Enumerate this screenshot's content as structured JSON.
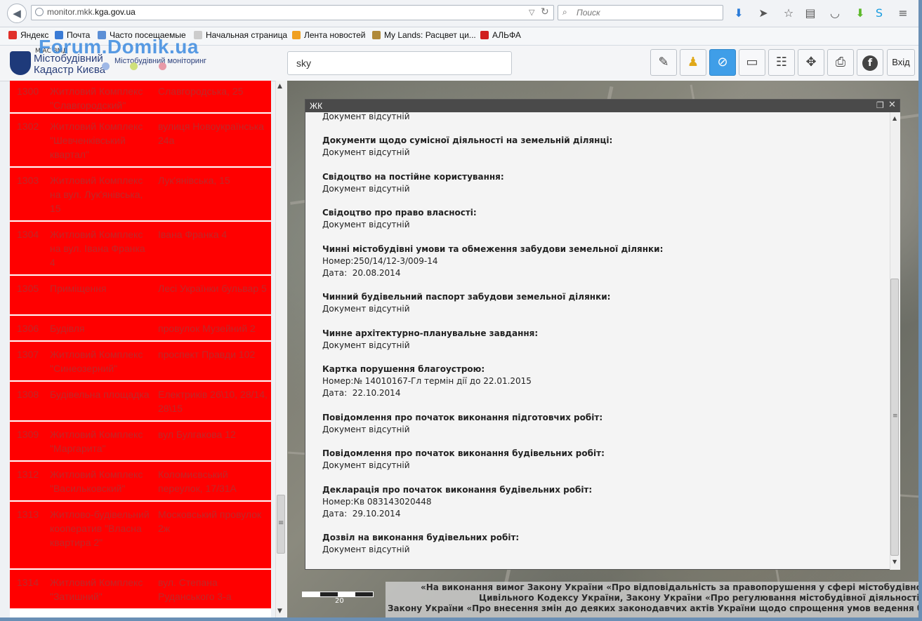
{
  "browser": {
    "url_prefix": "monitor.mkk.",
    "url_domain": "kga.gov.ua",
    "search_placeholder": "Поиск"
  },
  "bookmarks": [
    {
      "label": "Яндекс",
      "color": "#e0302a"
    },
    {
      "label": "Почта",
      "color": "#3a7bd5"
    },
    {
      "label": "Часто посещаемые",
      "color": "#5b8fd6"
    },
    {
      "label": "Начальная страница",
      "color": "#cccccc"
    },
    {
      "label": "Лента новостей",
      "color": "#f0a020"
    },
    {
      "label": "My Lands: Расцвет ци...",
      "color": "#b08a3a"
    },
    {
      "label": "АЛЬФА",
      "color": "#d02020"
    }
  ],
  "app": {
    "logo_top": "МІАС ЗМД",
    "logo_line1": "Містобудівний",
    "logo_line2": "Кадастр Києва",
    "logo_sub": "Містобудівний моніторинг",
    "watermark": "Forum.Domik.ua",
    "search_value": "sky",
    "exit_label": "Вхід"
  },
  "list": [
    {
      "id": "1300",
      "name": "Житловий Комплекс \"Славгородский\"",
      "address": "Славгородська, 25"
    },
    {
      "id": "1302",
      "name": "Житловий Комплекс \"Шевченківський квартал\"",
      "address": "вулиця Новоукраїнська 24а"
    },
    {
      "id": "1303",
      "name": "Житловий Комплекс на вул. Лук'янівська, 15",
      "address": "Лук'янівська, 15"
    },
    {
      "id": "1304",
      "name": "Житловий Комплекс на вул. Івана Франка 4",
      "address": "Івана Франка 4"
    },
    {
      "id": "1305",
      "name": "Приміщення",
      "address": "Лесі Українки бульвар 5"
    },
    {
      "id": "1306",
      "name": "Будівля",
      "address": "провулок Музейний 2"
    },
    {
      "id": "1307",
      "name": "Житловий Комплекс \"Синеозерний\"",
      "address": "проспект Правди 102"
    },
    {
      "id": "1308",
      "name": "Будівельна площадка",
      "address": "Електриків 26\\10, 28/14, 28\\15"
    },
    {
      "id": "1309",
      "name": "Житловий Комплекс \"Маргарита\"",
      "address": "вул Булгакова 12"
    },
    {
      "id": "1312",
      "name": "Житловий Комплекс \"Васильковский\"",
      "address": "Коломиєвський переулок, 17/31А"
    },
    {
      "id": "1313",
      "name": "Житлово-будівельний кооператив \"Власна квартира 2\"",
      "address": "Московський провулок 2ж"
    },
    {
      "id": "1314",
      "name": "Житловий Комплекс \"Затишний\"",
      "address": "вул. Степана Руданського 3-а"
    }
  ],
  "popup": {
    "title": "ЖК",
    "sections": [
      {
        "heading": "",
        "lines": [
          "Документ відсутній"
        ]
      },
      {
        "heading": "Документи щодо сумісної діяльності на земельній ділянці:",
        "lines": [
          "Документ відсутній"
        ]
      },
      {
        "heading": "Свідоцтво на постійне користування:",
        "lines": [
          "Документ відсутній"
        ]
      },
      {
        "heading": "Свідоцтво про право власності:",
        "lines": [
          "Документ відсутній"
        ]
      },
      {
        "heading": "Чинні містобудівні умови та обмеження забудови земельної ділянки:",
        "lines": [
          "Номер:250/14/12-3/009-14",
          "Дата:  20.08.2014"
        ]
      },
      {
        "heading": "Чинний будівельний паспорт забудови земельної ділянки:",
        "lines": [
          "Документ відсутній"
        ]
      },
      {
        "heading": "Чинне архітектурно-планувальне завдання:",
        "lines": [
          "Документ відсутній"
        ]
      },
      {
        "heading": "Картка порушення благоустрою:",
        "lines": [
          "Номер:№ 14010167-Гл термін дії до 22.01.2015",
          "Дата:  22.10.2014"
        ]
      },
      {
        "heading": "Повідомлення про початок виконання підготовчих робіт:",
        "lines": [
          "Документ відсутній"
        ]
      },
      {
        "heading": "Повідомлення про початок виконання будівельних робіт:",
        "lines": [
          "Документ відсутній"
        ]
      },
      {
        "heading": "Декларація про початок виконання будівельних робіт:",
        "lines": [
          "Номер:Кв 083143020448",
          "Дата:  29.10.2014"
        ]
      },
      {
        "heading": "Дозвіл на виконання будівельних робіт:",
        "lines": [
          "Документ відсутній"
        ]
      }
    ]
  },
  "ticker": [
    "«На виконання вимог Закону України «Про відповідальність за правопорушення у сфері містобудівної діяльності»",
    "Цивільного Кодексу України, Закону України «Про регулювання містобудівної діяльності»",
    "Закону України «Про внесення змін до деяких законодавчих актів України щодо спрощення умов ведення бізнесу"
  ],
  "map": {
    "scale_label": "20"
  }
}
